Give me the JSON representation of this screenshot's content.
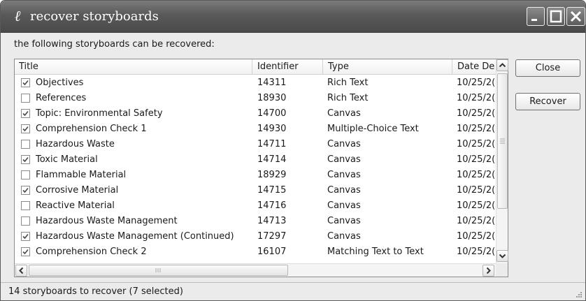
{
  "window": {
    "title": "recover storyboards",
    "app_icon": "app-logo-icon",
    "controls": [
      "minimize-icon",
      "maximize-icon",
      "close-icon"
    ]
  },
  "message": "the following storyboards can be recovered:",
  "table": {
    "columns": {
      "title": "Title",
      "identifier": "Identifier",
      "type": "Type",
      "date": "Date De"
    },
    "rows": [
      {
        "checked": true,
        "title": "Objectives",
        "identifier": "14311",
        "type": "Rich Text",
        "date": "10/25/2("
      },
      {
        "checked": false,
        "title": "References",
        "identifier": "18930",
        "type": "Rich Text",
        "date": "10/25/2("
      },
      {
        "checked": true,
        "title": "Topic: Environmental Safety",
        "identifier": "14700",
        "type": "Canvas",
        "date": "10/25/2("
      },
      {
        "checked": true,
        "title": "Comprehension Check 1",
        "identifier": "14930",
        "type": "Multiple-Choice Text",
        "date": "10/25/2("
      },
      {
        "checked": false,
        "title": "Hazardous Waste",
        "identifier": "14711",
        "type": "Canvas",
        "date": "10/25/2("
      },
      {
        "checked": true,
        "title": "Toxic Material",
        "identifier": "14714",
        "type": "Canvas",
        "date": "10/25/2("
      },
      {
        "checked": false,
        "title": "Flammable Material",
        "identifier": "18929",
        "type": "Canvas",
        "date": "10/25/2("
      },
      {
        "checked": true,
        "title": "Corrosive Material",
        "identifier": "14715",
        "type": "Canvas",
        "date": "10/25/2("
      },
      {
        "checked": false,
        "title": "Reactive Material",
        "identifier": "14716",
        "type": "Canvas",
        "date": "10/25/2("
      },
      {
        "checked": false,
        "title": "Hazardous Waste Management",
        "identifier": "14713",
        "type": "Canvas",
        "date": "10/25/2("
      },
      {
        "checked": true,
        "title": "Hazardous Waste Management (Continued)",
        "identifier": "17297",
        "type": "Canvas",
        "date": "10/25/2("
      },
      {
        "checked": true,
        "title": "Comprehension Check 2",
        "identifier": "16107",
        "type": "Matching Text to Text",
        "date": "10/25/2("
      }
    ]
  },
  "buttons": {
    "close": "Close",
    "recover": "Recover"
  },
  "status": "14 storyboards to recover (7 selected)"
}
